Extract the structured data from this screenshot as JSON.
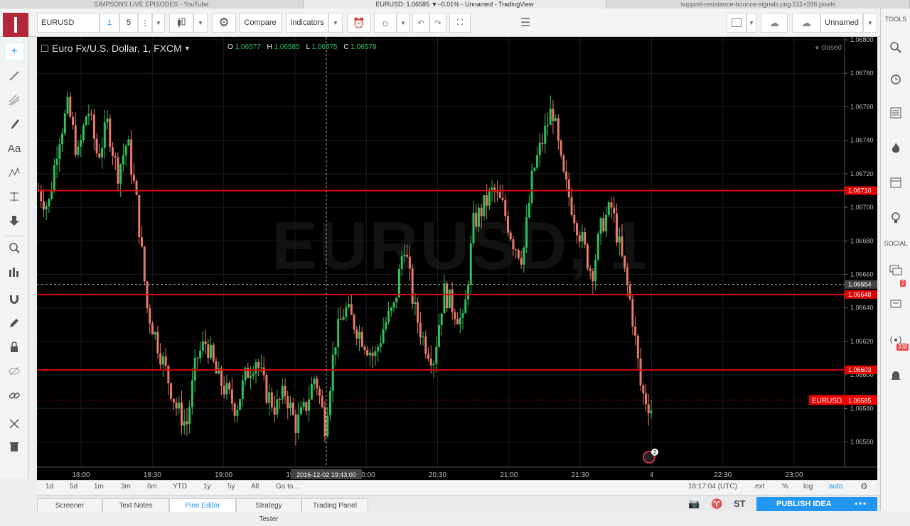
{
  "browser_tabs": [
    "SIMPSONS LIVE EPISODES - YouTube",
    "EURUSD: 1.06585 ▼−0.01% - Unnamed - TradingView",
    "support-resistance-bounce-signals.png 511×286 pixels"
  ],
  "toolbar": {
    "symbol": "EURUSD",
    "interval_1": "1",
    "interval_2": "5",
    "compare_label": "Compare",
    "indicators_label": "Indicators",
    "layout_name": "Unnamed"
  },
  "chart": {
    "title": "Euro Fx/U.S. Dollar, 1, FXCM",
    "ohlc": {
      "o_label": "O",
      "o": "1.06577",
      "h_label": "H",
      "h": "1.06585",
      "l_label": "L",
      "l": "1.06575",
      "c_label": "C",
      "c": "1.06578"
    },
    "status": "closed",
    "watermark": "EURUSD, 1",
    "crosshair_price": "1.06654",
    "crosshair_time": "2016-12-02 19:43:00",
    "last_symbol_label": "EURUSD",
    "last_price": "1.06585",
    "event_badge": "2",
    "colors": {
      "up": "#2ec05b",
      "down": "#e9796a",
      "level": "#e00000",
      "background": "#000000"
    }
  },
  "chart_data": {
    "type": "candlestick",
    "ylim": [
      1.06545,
      1.068
    ],
    "y_ticks": [
      "1.06800",
      "1.06780",
      "1.06760",
      "1.06740",
      "1.06720",
      "1.06700",
      "1.06680",
      "1.06660",
      "1.06640",
      "1.06620",
      "1.06600",
      "1.06580",
      "1.06560"
    ],
    "x_ticks": [
      "18:00",
      "18:30",
      "19:00",
      "19:30",
      "20:00",
      "20:30",
      "21:00",
      "21:30",
      "4",
      "22:30",
      "23:00"
    ],
    "levels": [
      "1.06710",
      "1.06648",
      "1.06603"
    ],
    "close_path": [
      1.0671,
      1.067,
      1.0674,
      1.0676,
      1.0673,
      1.0676,
      1.0673,
      1.0675,
      1.0672,
      1.0674,
      1.067,
      1.0664,
      1.0662,
      1.066,
      1.0658,
      1.0657,
      1.0661,
      1.0662,
      1.066,
      1.0659,
      1.0658,
      1.066,
      1.0661,
      1.0659,
      1.0658,
      1.0659,
      1.0657,
      1.0658,
      1.066,
      1.0657,
      1.0662,
      1.0664,
      1.0663,
      1.0662,
      1.0661,
      1.0663,
      1.0664,
      1.0668,
      1.0664,
      1.0662,
      1.0661,
      1.0665,
      1.0664,
      1.0663,
      1.0669,
      1.067,
      1.0671,
      1.067,
      1.0668,
      1.0667,
      1.0672,
      1.0674,
      1.0676,
      1.0672,
      1.067,
      1.0668,
      1.0666,
      1.0669,
      1.067,
      1.0667,
      1.0664,
      1.0659,
      1.0658
    ]
  },
  "range_bar": {
    "ranges": [
      "1d",
      "5d",
      "1m",
      "3m",
      "6m",
      "YTD",
      "1y",
      "5y",
      "All"
    ],
    "goto": "Go to...",
    "clock": "18:17:04 (UTC)",
    "options": [
      "ext",
      "%",
      "log",
      "auto"
    ]
  },
  "panel_tabs": [
    "Screener",
    "Text Notes",
    "Pine Editor",
    "Strategy Tester",
    "Trading Panel"
  ],
  "publish_label": "PUBLISH IDEA",
  "right_sidebar": {
    "tools_header": "TOOLS",
    "social_header": "SOCIAL",
    "chat_badge": "2",
    "streams_badge": "338"
  }
}
